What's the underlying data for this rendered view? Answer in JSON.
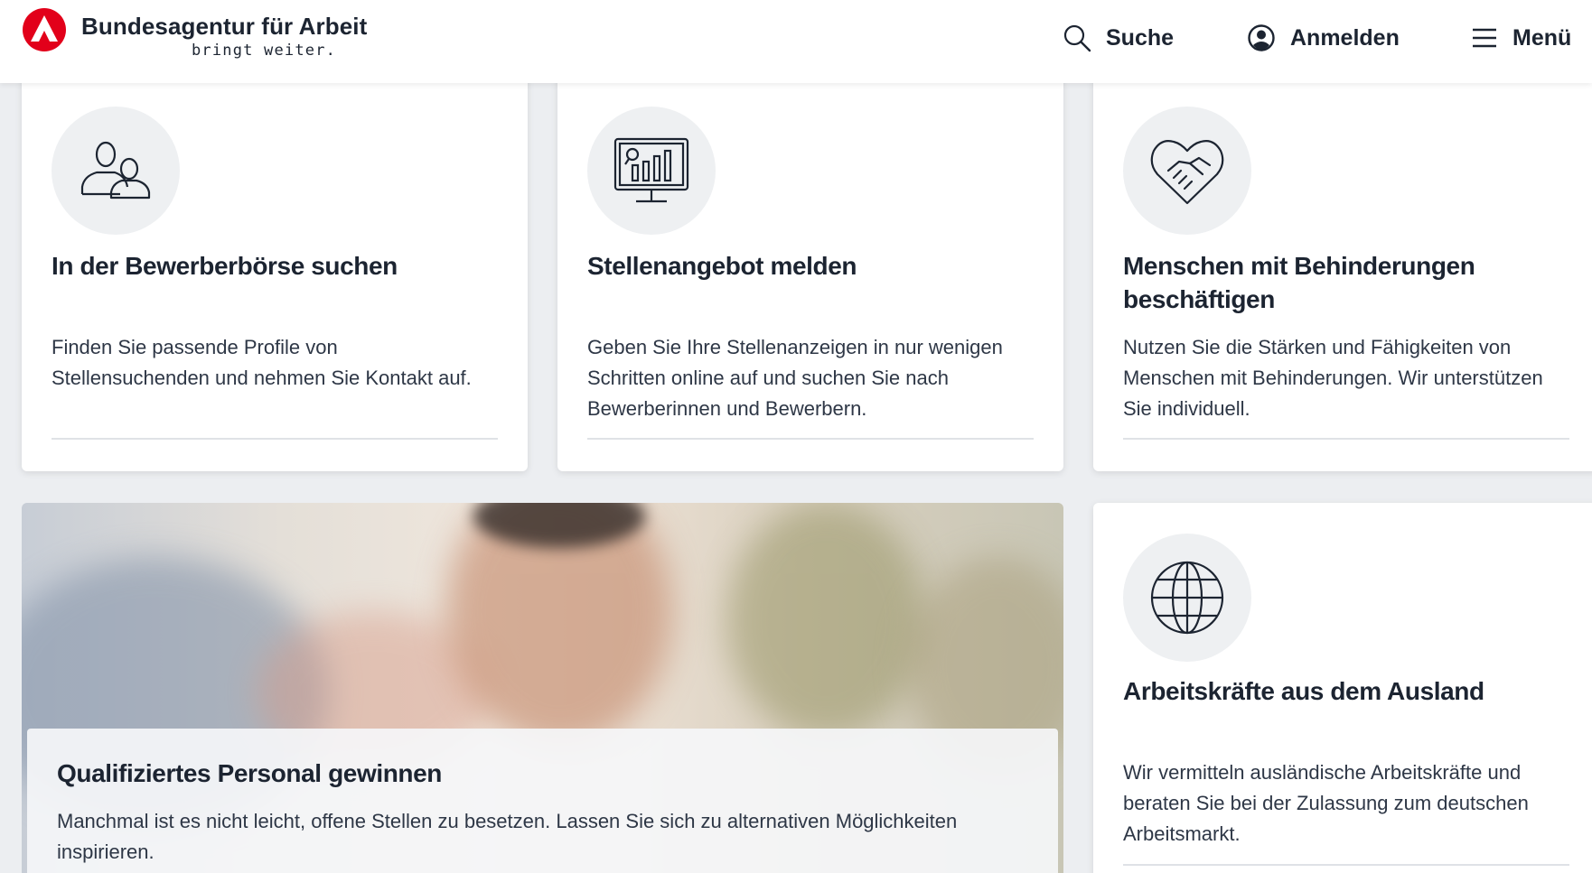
{
  "header": {
    "brand_name": "Bundesagentur für Arbeit",
    "brand_tagline": "bringt weiter.",
    "search_label": "Suche",
    "login_label": "Anmelden",
    "menu_label": "Menü",
    "brand_color": "#e2001a",
    "icons": {
      "search": "search-icon",
      "login": "user-circle-icon",
      "menu": "hamburger-menu-icon"
    }
  },
  "cards": [
    {
      "title": "In der Bewerberbörse suchen",
      "text": "Finden Sie passende Profile von Stellensuchenden und nehmen Sie Kontakt auf.",
      "icon": "people-icon"
    },
    {
      "title": "Stellenangebot melden",
      "text": "Geben Sie Ihre Stellenanzeigen in nur wenigen Schritten online auf und suchen Sie nach Bewerberinnen und Bewerbern.",
      "icon": "monitor-chart-icon"
    },
    {
      "title": "Menschen mit Behinderungen beschäftigen",
      "text": "Nutzen Sie die Stärken und Fähigkeiten von Menschen mit Behinderungen. Wir unterstützen Sie individuell.",
      "icon": "heart-handshake-icon"
    }
  ],
  "feature": {
    "title": "Qualifiziertes Personal gewinnen",
    "text": "Manchmal ist es nicht leicht, offene Stellen zu besetzen. Lassen Sie sich zu alternativen Möglichkeiten inspirieren."
  },
  "abroad_card": {
    "title": "Arbeitskräfte aus dem Ausland",
    "text": "Wir vermitteln ausländische Arbeitskräfte und beraten Sie bei der Zulassung zum deutschen Arbeitsmarkt.",
    "icon": "globe-icon"
  }
}
